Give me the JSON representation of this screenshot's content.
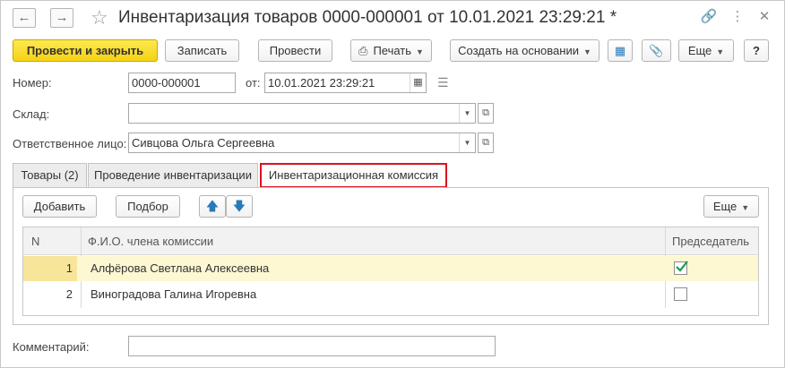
{
  "window": {
    "title": "Инвентаризация товаров 0000-000001 от 10.01.2021 23:29:21 *",
    "icons": [
      "back-arrow-icon",
      "forward-arrow-icon",
      "star-icon",
      "link-icon",
      "more-vert-icon",
      "close-icon"
    ]
  },
  "toolbar": {
    "post_close": "Провести и закрыть",
    "save": "Записать",
    "post": "Провести",
    "print": "Печать",
    "create_based": "Создать на основании",
    "more": "Еще",
    "help": "?"
  },
  "form": {
    "number_label": "Номер:",
    "number_value": "0000-000001",
    "date_label": "от:",
    "date_value": "10.01.2021 23:29:21",
    "warehouse_label": "Склад:",
    "warehouse_value": "",
    "responsible_label": "Ответственное лицо:",
    "responsible_value": "Сивцова Ольга Сергеевна",
    "comment_label": "Комментарий:",
    "comment_value": ""
  },
  "tabs": [
    {
      "label": "Товары (2)"
    },
    {
      "label": "Проведение инвентаризации"
    },
    {
      "label": "Инвентаризационная комиссия"
    }
  ],
  "panel": {
    "add": "Добавить",
    "select": "Подбор",
    "more": "Еще"
  },
  "table": {
    "columns": [
      "N",
      "Ф.И.О. члена комиссии",
      "Председатель"
    ],
    "rows": [
      {
        "n": "1",
        "name": "Алфёрова Светлана Алексеевна",
        "chairman": true
      },
      {
        "n": "2",
        "name": "Виноградова Галина Игоревна",
        "chairman": false
      }
    ]
  },
  "colors": {
    "primary_button": "#f5d214",
    "tab_highlight": "#d9141c",
    "selected_row": "#fdf7d2",
    "check": "#1a9a4a"
  }
}
